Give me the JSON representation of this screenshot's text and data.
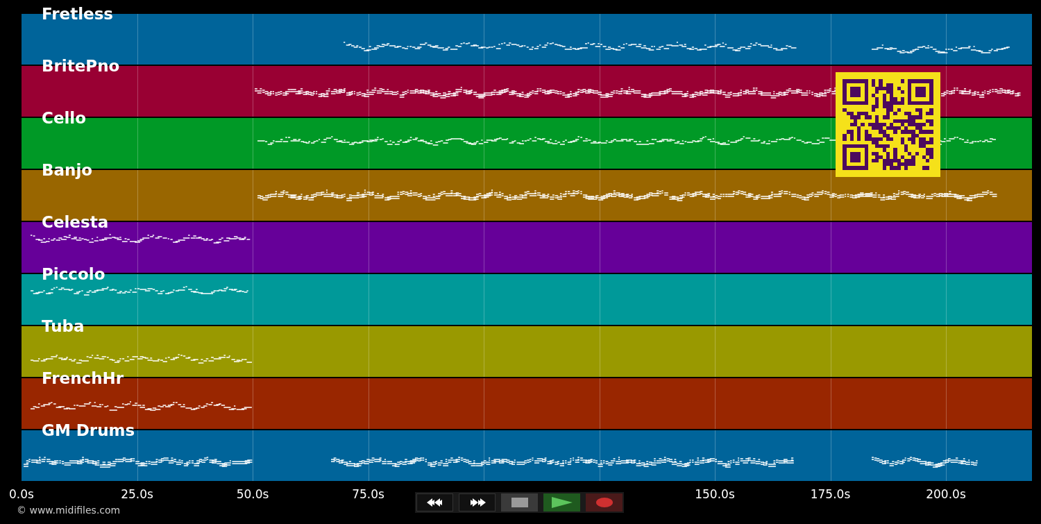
{
  "tracks": [
    {
      "name": "Fretless",
      "color": "#00649a"
    },
    {
      "name": "BritePno",
      "color": "#990033"
    },
    {
      "name": "Cello",
      "color": "#009926"
    },
    {
      "name": "Banjo",
      "color": "#996600"
    },
    {
      "name": "Celesta",
      "color": "#660099"
    },
    {
      "name": "Piccolo",
      "color": "#009999"
    },
    {
      "name": "Tuba",
      "color": "#999900"
    },
    {
      "name": "FrenchHr",
      "color": "#992600"
    },
    {
      "name": "GM Drums",
      "color": "#00649a"
    }
  ],
  "time_axis": [
    "0.0s",
    "25.0s",
    "50.0s",
    "75.0s",
    "150.0s",
    "175.0s",
    "200.0s"
  ],
  "credit": "© www.midifiles.com",
  "controls": [
    {
      "kind": "rewind"
    },
    {
      "kind": "forward"
    },
    {
      "kind": "stop"
    },
    {
      "kind": "play"
    },
    {
      "kind": "record"
    }
  ]
}
